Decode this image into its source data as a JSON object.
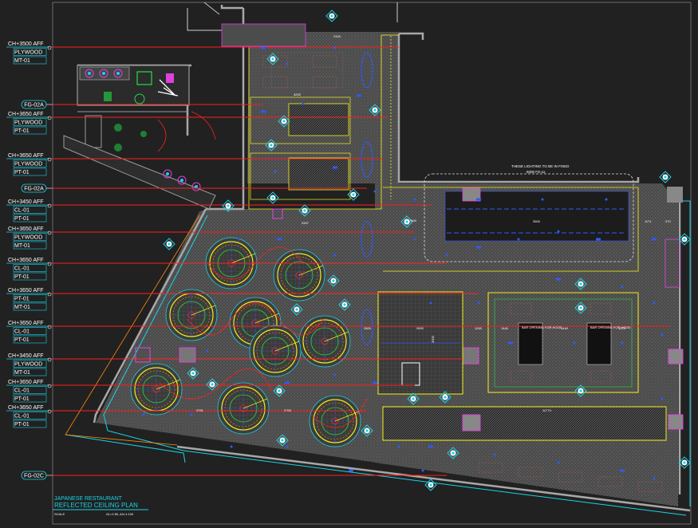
{
  "drawing": {
    "title_line1": "JAPANESE RESTAURANT",
    "title_line2": "REFLECTED CEILING PLAN",
    "scale_label": "SCALE",
    "scale_value": "A1=1:50, A3=1:100"
  },
  "tags": [
    {
      "lines": [
        "CH+3500  AFF",
        "PLYWOOD",
        "MT-01"
      ]
    },
    {
      "lines": [
        "FG-02A"
      ]
    },
    {
      "lines": [
        "CH+3650  AFF",
        "PLYWOOD",
        "PT-01"
      ]
    },
    {
      "lines": [
        "CH+3650  AFF",
        "PLYWOOD",
        "PT-01"
      ]
    },
    {
      "lines": [
        "FG-02A"
      ]
    },
    {
      "lines": [
        "CH+3450  AFF",
        "CL-01",
        "PT-01"
      ]
    },
    {
      "lines": [
        "CH+3650  AFF",
        "PLYWOOD",
        "MT-01"
      ]
    },
    {
      "lines": [
        "CH+3650  AFF",
        "CL-01",
        "PT-01"
      ]
    },
    {
      "lines": [
        "CH+3650  AFF",
        "PT-01",
        "MT-01"
      ]
    },
    {
      "lines": [
        "CH+3650  AFF",
        "CL-01",
        "PT-01"
      ]
    },
    {
      "lines": [
        "CH+3450  AFF",
        "PLYWOOD",
        "MT-01"
      ]
    },
    {
      "lines": [
        "CH+3650  AFF",
        "CL-01",
        "PT-01"
      ]
    },
    {
      "lines": [
        "CH+3650  AFF",
        "CL-01",
        "PT-01"
      ]
    },
    {
      "lines": [
        "FG-02C"
      ]
    }
  ],
  "notes": {
    "lighting_note_1": "THESE LIGHTING TO BE IN FIXED",
    "lighting_note_2": "6000 FG-xx",
    "dim_bar": "3500",
    "bar_opening_a": "BAR OPENING FOR HOOD",
    "bar_opening_b": "BAR OPENING FOR HOOD",
    "dim_a": "2500",
    "dim_b": "1200",
    "dim_c": "1440",
    "dim_d": "1440",
    "dim_e": "1373",
    "dim_f": "2600",
    "dim_g": "11774",
    "dim_h": "2800",
    "dim_i": "2907",
    "dim_j": "3751",
    "dim_k": "2700",
    "dim_l": "2324",
    "dim_m": "4200",
    "dim_n": "3000",
    "dim_o": "1171",
    "dim_p": "270"
  },
  "colors": {
    "background": "#212121",
    "wall": "#9a9a9a",
    "cyan": "#19d3e6",
    "red": "#ff2020",
    "yellow": "#f2ef1a",
    "blue": "#2d5bff",
    "magenta": "#e040e0",
    "orange": "#ff8a10",
    "green": "#22dd44"
  }
}
